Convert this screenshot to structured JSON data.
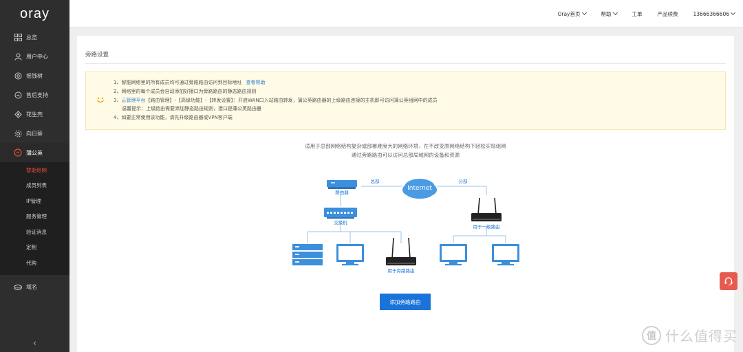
{
  "brand": "oray",
  "sidebar": {
    "items": [
      {
        "label": "总览",
        "icon": "grid-icon"
      },
      {
        "label": "用户中心",
        "icon": "user-icon"
      },
      {
        "label": "摇钱树",
        "icon": "tree-icon"
      },
      {
        "label": "售后支持",
        "icon": "support-icon"
      },
      {
        "label": "花生壳",
        "icon": "peanut-icon"
      },
      {
        "label": "向日葵",
        "icon": "sunflower-icon"
      }
    ],
    "open_item": {
      "label": "蒲公英",
      "icon": "dandelion-icon"
    },
    "sub_items": [
      "智能组网",
      "成员列表",
      "IP管理",
      "服务管理",
      "验证消息",
      "定制",
      "代购"
    ],
    "active_sub": "智能组网",
    "domain_item": {
      "label": "域名",
      "icon": "www-icon"
    },
    "collapse_glyph": "‹"
  },
  "topbar": {
    "home": "Oray首页",
    "help": "帮助",
    "ticket": "工单",
    "renew": "产品续费",
    "account": "13666366606"
  },
  "page": {
    "title": "旁路设置",
    "notice": {
      "line1": "1、智能网络里的所有成员均可通过旁路路由访问到目标地址",
      "line1_link": "查看帮助",
      "line2": "2、网络里的每个成员会自动添加好接口为旁路路由的静态路由规则",
      "line3_prefix": "3、",
      "line3_link": "云管理平台",
      "line3_text": "【路由管理】-【高级功能】-【转发设置】：开启WAN口入站路由转发，蒲公英路由器的上级路由连接的主机即可访问蒲公英组网中的成员",
      "line3b": "温馨提示：上级路由需要添加静态路由规则，接口是蒲公英路由器",
      "line4": "4、如要正常使用该功能，请先升级路由器或VPN客户端"
    },
    "desc_line1": "适用于总部网络结构复杂或部署难度大的网络环境，在不改变原网络结构下轻松实现组网",
    "desc_line2": "通过旁路路由可以访问总部局域网的设备和资源",
    "diagram": {
      "internet": "Internet",
      "hq": "总部",
      "branch": "分部",
      "router": "路由器",
      "switch": "交换机",
      "bypass_router": "用于旁路路由",
      "level1_router": "用于一级路由"
    },
    "add_button": "添加旁路路由"
  },
  "watermark": {
    "glyph": "值",
    "text": "什么值得买"
  },
  "colors": {
    "accent": "#1a73d9",
    "active": "#e64b3c",
    "sidebar": "#2e2e2e",
    "notice_bg": "#fffbe6"
  }
}
